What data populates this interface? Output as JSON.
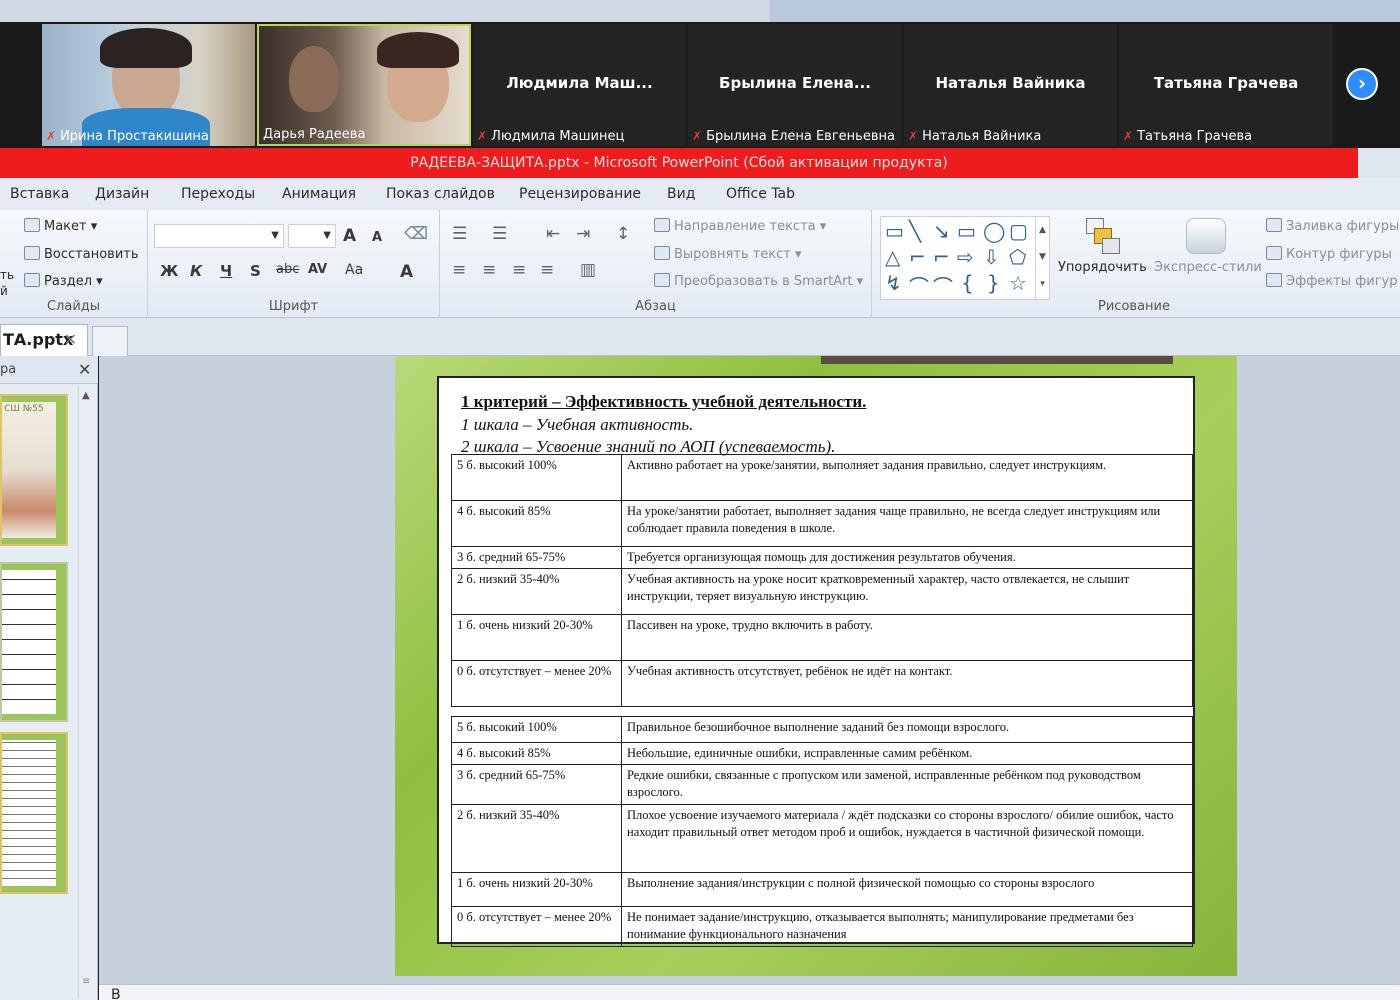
{
  "participants": [
    {
      "name": "Ирина Простакишина",
      "muted": true,
      "video": true
    },
    {
      "name": "Дарья Радеева",
      "muted": false,
      "video": true
    },
    {
      "name": "Людмила Машинец",
      "display": "Людмила  Маш...",
      "muted": true,
      "video": false
    },
    {
      "name": "Брылина Елена Евгеньевна",
      "display": "Брылина  Елена...",
      "muted": true,
      "video": false
    },
    {
      "name": "Наталья Вайника",
      "display": "Наталья Вайника",
      "muted": true,
      "video": false
    },
    {
      "name": "Татьяна Грачева",
      "display": "Татьяна Грачева",
      "muted": true,
      "video": false
    }
  ],
  "window_title": "РАДЕЕВА-ЗАЩИТА.pptx  -  Microsoft PowerPoint (Сбой активации продукта)",
  "ribbon": {
    "tabs": [
      "Вставка",
      "Дизайн",
      "Переходы",
      "Анимация",
      "Показ слайдов",
      "Рецензирование",
      "Вид",
      "Office Tab"
    ],
    "slides_group": {
      "layout": "Макет",
      "reset": "Восстановить",
      "section": "Раздел",
      "caption": "Слайды",
      "cut_a": "ть",
      "cut_b": "й"
    },
    "font_group": {
      "caption": "Шрифт",
      "bold": "Ж",
      "italic": "К",
      "underline": "Ч",
      "shadow": "S",
      "strike": "abc",
      "spacing": "AV",
      "case": "Aa",
      "color": "A",
      "grow": "A",
      "shrink": "A"
    },
    "paragraph_group": {
      "caption": "Абзац",
      "text_direction": "Направление текста",
      "align_text": "Выровнять текст",
      "smartart": "Преобразовать в SmartArt"
    },
    "drawing_group": {
      "caption": "Рисование",
      "arrange": "Упорядочить",
      "quick_styles": "Экспресс-стили",
      "fill": "Заливка фигуры",
      "outline": "Контур фигуры",
      "effects": "Эффекты фигур"
    }
  },
  "doc_tab": {
    "label": "ТА.pptx",
    "close": "✕"
  },
  "slides_panel": {
    "header": "ра",
    "close": "✕",
    "thumb_text": "СШ №55"
  },
  "slide": {
    "heading": "1 критерий – Эффективность учебной деятельности.",
    "scale1": "1 шкала – Учебная активность.",
    "scale2": "2 шкала – Усвоение знаний по АОП (успеваемость).",
    "table1": [
      {
        "level": "5 б. высокий 100%",
        "desc": "Активно работает на уроке/занятии, выполняет задания  правильно, следует инструкциям."
      },
      {
        "level": "4 б. высокий 85%",
        "desc": "На уроке/занятии работает, выполняет задания  чаще правильно, не всегда следует инструкциям или соблюдает  правила поведения в школе."
      },
      {
        "level": "3 б. средний 65-75%",
        "desc": "Требуется организующая помощь для достижения результатов обучения."
      },
      {
        "level": "2 б. низкий 35-40%",
        "desc": "Учебная активность на уроке носит кратковременный характер, часто отвлекается, не слышит  инструкции, теряет визуальную  инструкцию."
      },
      {
        "level": "1 б. очень низкий 20-30%",
        "desc": "Пассивен на уроке, трудно включить в работу."
      },
      {
        "level": "0 б. отсутствует – менее 20%",
        "desc": "Учебная активность отсутствует, ребёнок не идёт на контакт."
      }
    ],
    "table2": [
      {
        "level": "5 б. высокий 100%",
        "desc": "Правильное безошибочное выполнение заданий  без помощи взрослого."
      },
      {
        "level": "4 б. высокий 85%",
        "desc": "Небольшие, единичные ошибки, исправленные самим ребёнком."
      },
      {
        "level": "3 б. средний 65-75%",
        "desc": "Редкие ошибки, связанные с пропуском или  заменой,  исправленные ребёнком под руководством взрослого."
      },
      {
        "level": "2 б. низкий 35-40%",
        "desc": "Плохое усвоение изучаемого материала / ждёт    подсказки со стороны взрослого/ обилие ошибок, часто находит правильный ответ методом проб и ошибок, нуждается  в частичной физической  помощи."
      },
      {
        "level": "1 б. очень низкий 20-30%",
        "desc": "Выполнение  задания/инструкции с полной физической помощью со стороны взрослого"
      },
      {
        "level": "0 б. отсутствует – менее 20%",
        "desc": "Не понимает задание/инструкцию, отказывается   выполнять;  манипулирование предметами без понимание функционального назначения"
      }
    ]
  },
  "notes_placeholder": "В",
  "colors": {
    "title_bar": "#ee1c1c",
    "slide_green": "#9cc45b",
    "zoom_blue": "#2d8cff",
    "active_speaker": "#b6d84a"
  }
}
